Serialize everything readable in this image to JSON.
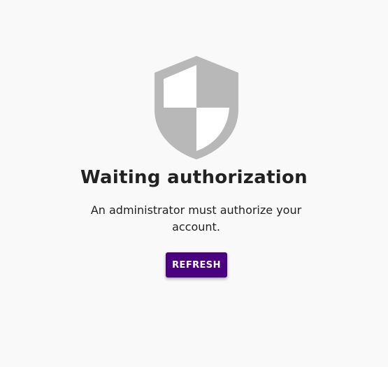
{
  "auth": {
    "icon": "shield-icon",
    "title": "Waiting authorization",
    "message": "An administrator must authorize your account.",
    "refresh_label": "REFRESH"
  },
  "colors": {
    "background": "#f9f9f9",
    "icon": "#b8b8b8",
    "button": "#4b0082",
    "button_text": "#ffffff",
    "text": "#222222"
  }
}
